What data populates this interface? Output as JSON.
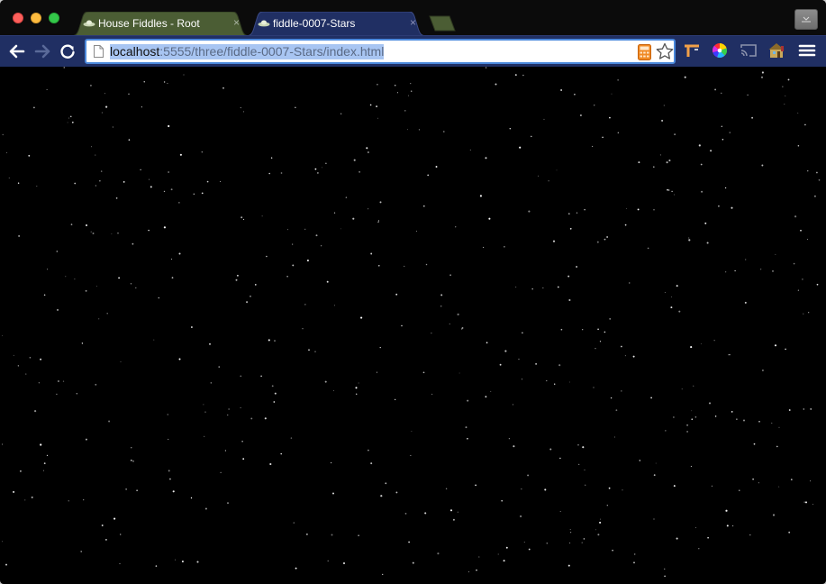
{
  "window": {
    "tabs": [
      {
        "title": "House Fiddles - Root",
        "close": "×",
        "active": false
      },
      {
        "title": "fiddle-0007-Stars",
        "close": "×",
        "active": true
      }
    ]
  },
  "toolbar": {
    "url": {
      "host": "localhost",
      "path": ":5555/three/fiddle-0007-Stars/index.html"
    }
  },
  "colors": {
    "toolbar_bg": "#202f63",
    "inactive_tab": "#4b5d34",
    "active_tab": "#202f63",
    "selection": "#a8c5f2",
    "page_bg": "#000000"
  },
  "icons": [
    "back-icon",
    "forward-icon",
    "reload-icon",
    "page-icon",
    "calculator-icon",
    "star-icon",
    "extension-t-icon",
    "color-wheel-icon",
    "cast-icon",
    "house-icon",
    "menu-icon"
  ]
}
